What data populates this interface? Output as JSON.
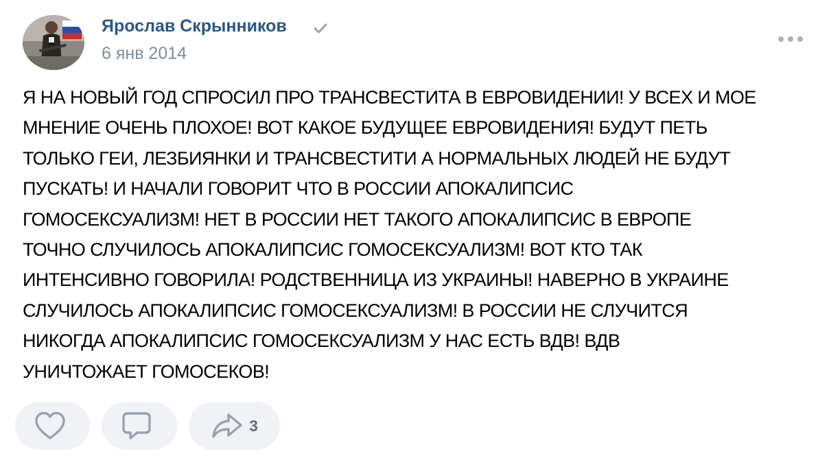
{
  "post": {
    "author": {
      "name": "Ярослав Скрынников",
      "verified": true
    },
    "date": "6 янв 2014",
    "text": "Я НА НОВЫЙ ГОД СПРОСИЛ ПРО ТРАНСВЕСТИТА В ЕВРОВИДЕНИИ! У ВСЕХ И МОЕ\nМНЕНИЕ ОЧЕНЬ ПЛОХОЕ! ВОТ КАКОЕ БУДУЩЕЕ ЕВРОВИДЕНИЯ! БУДУТ ПЕТЬ\nТОЛЬКО ГЕИ, ЛЕЗБИЯНКИ И ТРАНСВЕСТИТИ А НОРМАЛЬНЫХ ЛЮДЕЙ НЕ БУДУТ\nПУСКАТЬ! И НАЧАЛИ ГОВОРИТ ЧТО В РОССИИ АПОКАЛИПСИС\nГОМОСЕКСУАЛИЗМ! НЕТ В РОССИИ НЕТ ТАКОГО АПОКАЛИПСИС В ЕВРОПЕ\nТОЧНО СЛУЧИЛОСЬ АПОКАЛИПСИС ГОМОСЕКСУАЛИЗМ! ВОТ КТО ТАК\nИНТЕНСИВНО ГОВОРИЛА! РОДСТВЕННИЦА ИЗ УКРАИНЫ! НАВЕРНО В УКРАИНЕ\nСЛУЧИЛОСЬ АПОКАЛИПСИС ГОМОСЕКСУАЛИЗМ! В РОССИИ НЕ СЛУЧИТСЯ\nНИКОГДА АПОКАЛИПСИС ГОМОСЕКСУАЛИЗМ У НАС ЕСТЬ ВДВ! ВДВ\nУНИЧТОЖАЕТ ГОМОСЕКОВ!",
    "actions": {
      "like": {
        "icon": "heart-icon",
        "count": ""
      },
      "comment": {
        "icon": "comment-icon",
        "count": ""
      },
      "share": {
        "icon": "share-arrow-icon",
        "count": "3"
      }
    }
  },
  "colors": {
    "author_link": "#2a5885",
    "secondary_text": "#818c99",
    "button_bg": "#f0f2f5",
    "icon": "#99a2ad"
  }
}
